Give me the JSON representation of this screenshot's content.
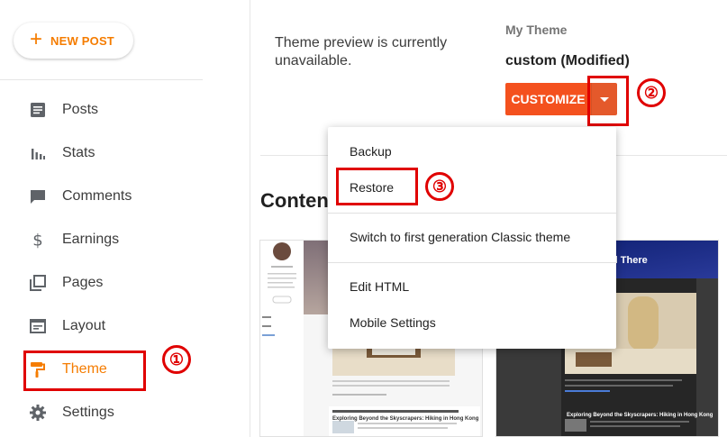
{
  "sidebar": {
    "new_post_label": "NEW POST",
    "items": [
      {
        "label": "Posts",
        "icon": "posts-icon"
      },
      {
        "label": "Stats",
        "icon": "stats-icon"
      },
      {
        "label": "Comments",
        "icon": "comments-icon"
      },
      {
        "label": "Earnings",
        "icon": "dollar-icon"
      },
      {
        "label": "Pages",
        "icon": "pages-icon"
      },
      {
        "label": "Layout",
        "icon": "layout-icon"
      },
      {
        "label": "Theme",
        "icon": "paint-roller-icon",
        "active": true
      },
      {
        "label": "Settings",
        "icon": "gear-icon"
      }
    ]
  },
  "main": {
    "preview_message": "Theme preview is currently unavailable.",
    "my_theme_label": "My Theme",
    "theme_name": "custom (Modified)",
    "customize_label": "CUSTOMIZE",
    "content_heading": "Conten"
  },
  "menu": {
    "items": [
      "Backup",
      "Restore",
      "Switch to first generation Classic theme",
      "Edit HTML",
      "Mobile Settings"
    ]
  },
  "thumbnails": {
    "post_title": "Exploring Beyond the Skyscrapers: Hiking in Hong Kong",
    "dark_header": "e and There"
  },
  "annotations": {
    "step1": "①",
    "step2": "②",
    "step3": "③"
  },
  "colors": {
    "accent": "#f57c00",
    "customize": "#f4511e",
    "annotation": "#e00000"
  }
}
